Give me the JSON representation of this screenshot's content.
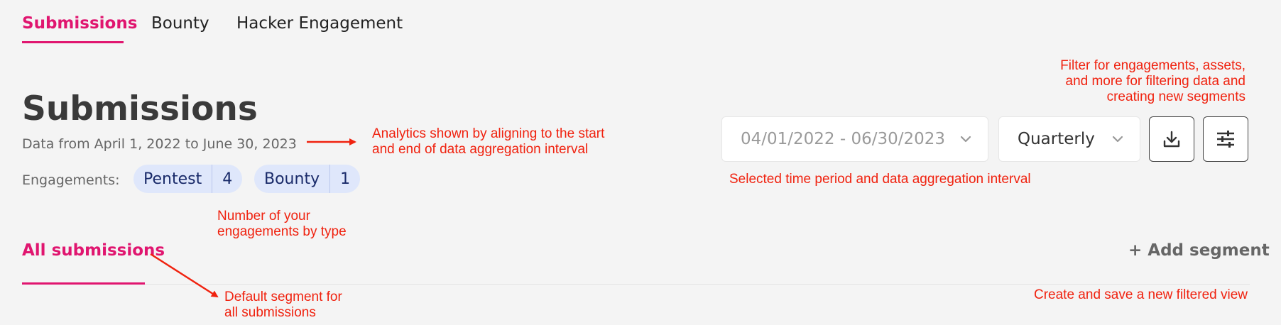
{
  "tabs": [
    {
      "label": "Submissions",
      "active": true
    },
    {
      "label": "Bounty",
      "active": false
    },
    {
      "label": "Hacker Engagement",
      "active": false
    }
  ],
  "header": {
    "title": "Submissions",
    "subtitle": "Data from April 1, 2022 to June 30, 2023"
  },
  "engagements": {
    "label": "Engagements:",
    "items": [
      {
        "name": "Pentest",
        "count": "4"
      },
      {
        "name": "Bounty",
        "count": "1"
      }
    ]
  },
  "controls": {
    "date_range": "04/01/2022 - 06/30/2023",
    "interval": "Quarterly",
    "download_icon": "download-icon",
    "filter_icon": "sliders-icon"
  },
  "segments": {
    "active": "All submissions",
    "add_label": "+ Add segment"
  },
  "annotations": {
    "analytics": [
      "Analytics shown by aligning to the start",
      "and end of data aggregation interval"
    ],
    "filter": [
      "Filter for engagements, assets,",
      "and more for filtering data and",
      "creating new segments"
    ],
    "selected": "Selected time period and data aggregation interval",
    "engagements": [
      "Number of your",
      "engagements by type"
    ],
    "default_segment": [
      "Default segment for",
      "all submissions"
    ],
    "create_view": "Create and save a new filtered view"
  },
  "colors": {
    "accent": "#e0156f",
    "annotation": "#f0220f",
    "pill_bg": "#dfe7fb",
    "pill_text": "#1a2b6a",
    "background": "#f4f4f4"
  }
}
